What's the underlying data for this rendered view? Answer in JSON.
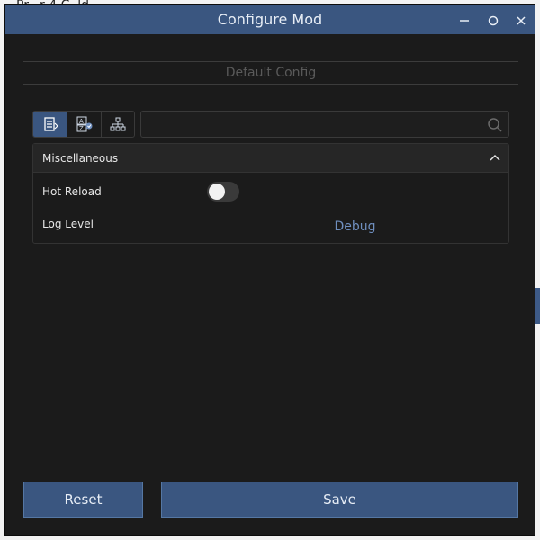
{
  "background": {
    "top_fragment": "Pr...r 4 C..ld.."
  },
  "window": {
    "title": "Configure Mod",
    "controls": {
      "minimize": "—",
      "maximize": "O",
      "close": "X"
    }
  },
  "config": {
    "header": "Default Config"
  },
  "toolbar": {
    "buttons": [
      {
        "name": "categorized-view",
        "active": true
      },
      {
        "name": "alphabetical-sort",
        "active": false
      },
      {
        "name": "hierarchy-view",
        "active": false
      }
    ]
  },
  "search": {
    "value": "",
    "placeholder": ""
  },
  "groups": [
    {
      "title": "Miscellaneous",
      "expanded": true,
      "items": [
        {
          "label": "Hot Reload",
          "type": "toggle",
          "value": false
        },
        {
          "label": "Log Level",
          "type": "dropdown",
          "value": "Debug"
        }
      ]
    }
  ],
  "actions": {
    "reset_label": "Reset",
    "save_label": "Save"
  },
  "colors": {
    "accent": "#3a5680",
    "link": "#6f8fbf",
    "background": "#1b1b1b"
  }
}
